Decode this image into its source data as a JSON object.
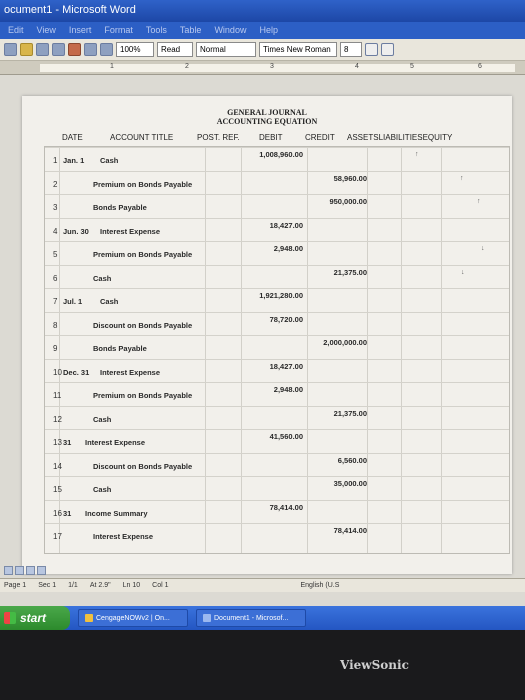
{
  "window": {
    "title": "ocument1 - Microsoft Word"
  },
  "menu": [
    "Edit",
    "View",
    "Insert",
    "Format",
    "Tools",
    "Table",
    "Window",
    "Help"
  ],
  "toolbar": {
    "zoom": "100%",
    "read": "Read",
    "style": "Normal",
    "font": "Times New Roman",
    "size": "8"
  },
  "ruler": [
    "1",
    "2",
    "3",
    "4",
    "5",
    "6"
  ],
  "document": {
    "title1": "GENERAL JOURNAL",
    "title2": "ACCOUNTING EQUATION",
    "headers": {
      "date": "DATE",
      "account": "ACCOUNT TITLE",
      "post": "POST. REF.",
      "debit": "DEBIT",
      "credit": "CREDIT",
      "eq": "ASSETSLIABILITIESEQUITY"
    },
    "rows": [
      {
        "n": "1",
        "date": "Jan. 1",
        "account": "Cash",
        "debit": "1,008,960.00",
        "credit": ""
      },
      {
        "n": "2",
        "date": "",
        "account": "Premium on Bonds Payable",
        "debit": "",
        "credit": "58,960.00"
      },
      {
        "n": "3",
        "date": "",
        "account": "Bonds Payable",
        "debit": "",
        "credit": "950,000.00"
      },
      {
        "n": "4",
        "date": "Jun. 30",
        "account": "Interest Expense",
        "debit": "18,427.00",
        "credit": ""
      },
      {
        "n": "5",
        "date": "",
        "account": "Premium on Bonds Payable",
        "debit": "2,948.00",
        "credit": ""
      },
      {
        "n": "6",
        "date": "",
        "account": "Cash",
        "debit": "",
        "credit": "21,375.00"
      },
      {
        "n": "7",
        "date": "Jul. 1",
        "account": "Cash",
        "debit": "1,921,280.00",
        "credit": ""
      },
      {
        "n": "8",
        "date": "",
        "account": "Discount on Bonds Payable",
        "debit": "78,720.00",
        "credit": ""
      },
      {
        "n": "9",
        "date": "",
        "account": "Bonds Payable",
        "debit": "",
        "credit": "2,000,000.00"
      },
      {
        "n": "10",
        "date": "Dec. 31",
        "account": "Interest Expense",
        "debit": "18,427.00",
        "credit": ""
      },
      {
        "n": "11",
        "date": "",
        "account": "Premium on Bonds Payable",
        "debit": "2,948.00",
        "credit": ""
      },
      {
        "n": "12",
        "date": "",
        "account": "Cash",
        "debit": "",
        "credit": "21,375.00"
      },
      {
        "n": "13",
        "date": "31",
        "account": "Interest Expense",
        "debit": "41,560.00",
        "credit": ""
      },
      {
        "n": "14",
        "date": "",
        "account": "Discount on Bonds Payable",
        "debit": "",
        "credit": "6,560.00"
      },
      {
        "n": "15",
        "date": "",
        "account": "Cash",
        "debit": "",
        "credit": "35,000.00"
      },
      {
        "n": "16",
        "date": "31",
        "account": "Income Summary",
        "debit": "78,414.00",
        "credit": ""
      },
      {
        "n": "17",
        "date": "",
        "account": "Interest Expense",
        "debit": "",
        "credit": "78,414.00"
      }
    ],
    "equation_marks": [
      "↑",
      "↑",
      "↑",
      "↓",
      "↓"
    ]
  },
  "status": {
    "page": "Page 1",
    "sec": "Sec 1",
    "pages": "1/1",
    "at": "At 2.9\"",
    "ln": "Ln 10",
    "col": "Col 1",
    "lang": "English (U.S"
  },
  "taskbar": {
    "start": "start",
    "task1": "CengageNOWv2 | On...",
    "task2": "Document1 - Microsof..."
  },
  "bezel": {
    "brand": "ViewSonic"
  }
}
